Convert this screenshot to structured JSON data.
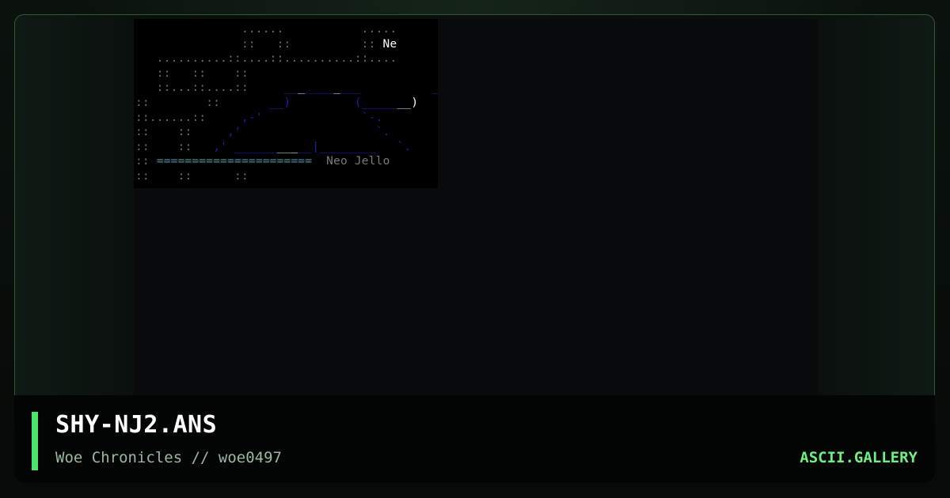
{
  "file": {
    "title": "SHY-NJ2.ANS",
    "subtitle": "Woe Chronicles // woe0497"
  },
  "site": {
    "brand": "ASCII.GALLERY"
  },
  "art": {
    "label_top": "Ne",
    "label_bottom": "Neo Jello",
    "equals_rule": "======================"
  },
  "colors": {
    "accent": "#4ce56a",
    "brand": "#6ef081",
    "frame_border": "#2f5a35",
    "art_blue": "#1e1ea8",
    "art_gray": "#6c6c6c"
  }
}
